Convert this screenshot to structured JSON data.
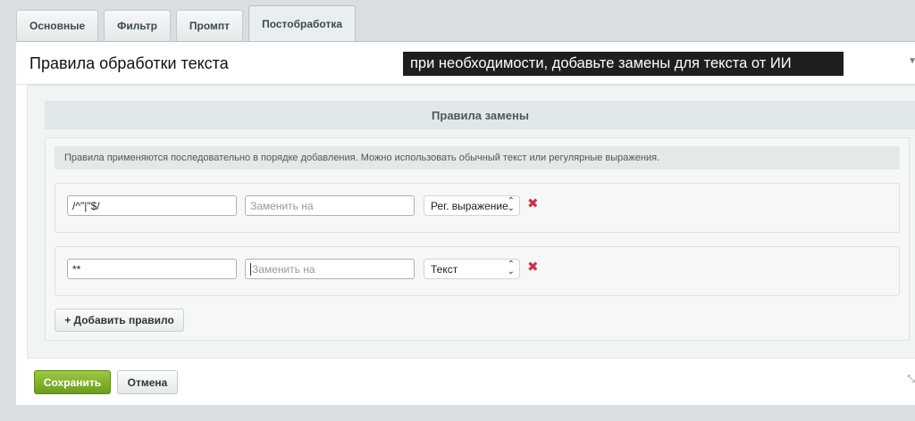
{
  "tabs": [
    {
      "label": "Основные"
    },
    {
      "label": "Фильтр"
    },
    {
      "label": "Промпт"
    },
    {
      "label": "Постобработка",
      "active": true
    }
  ],
  "panel": {
    "title": "Правила обработки текста",
    "tooltip": "при необходимости, добавьте замены для текста от ИИ"
  },
  "rules": {
    "header": "Правила замены",
    "info": "Правила применяются последовательно в порядке добавления. Можно использовать обычный текст или регулярные выражения.",
    "items": [
      {
        "search_value": "/^\"|\"$/",
        "replace_placeholder": "Заменить на",
        "type": "Рег. выражение"
      },
      {
        "search_value": "**",
        "replace_placeholder": "Заменить на",
        "type": "Текст"
      }
    ],
    "add_label": "+ Добавить правило",
    "remove_glyph": "✖"
  },
  "footer": {
    "save_label": "Сохранить",
    "cancel_label": "Отмена"
  },
  "colors": {
    "accent_green": "#7aa829",
    "remove_red": "#c9324a"
  }
}
